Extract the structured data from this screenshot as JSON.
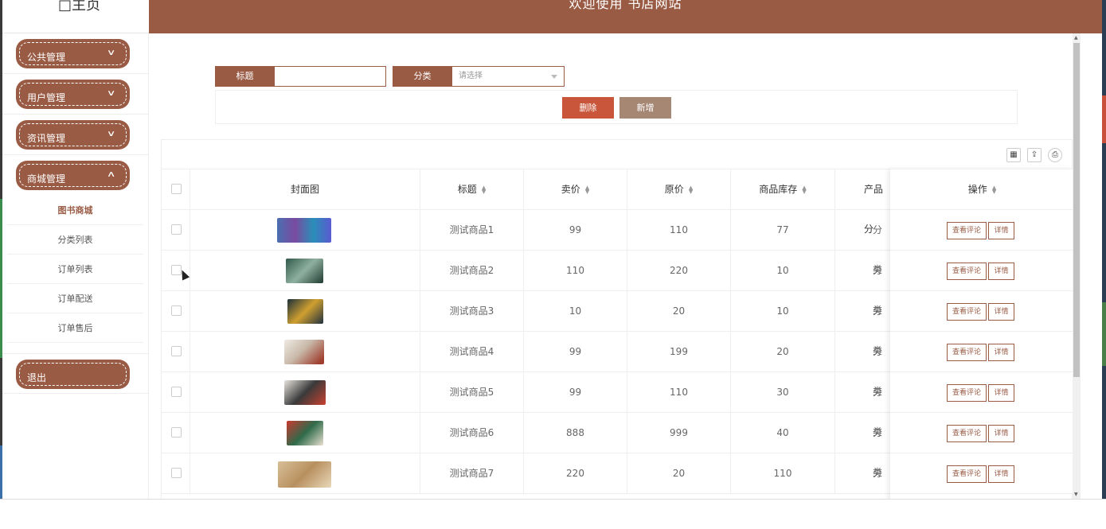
{
  "header": {
    "title": "欢迎使用 书店网站",
    "logo": "□主页"
  },
  "sidebar": {
    "menus": [
      {
        "label": "公共管理",
        "chevron": "down"
      },
      {
        "label": "用户管理",
        "chevron": "down"
      },
      {
        "label": "资讯管理",
        "chevron": "down"
      },
      {
        "label": "商城管理",
        "chevron": "up"
      }
    ],
    "subitems": [
      "图书商城",
      "分类列表",
      "订单列表",
      "订单配送",
      "订单售后"
    ],
    "active_sub": "图书商城",
    "logout": "退出"
  },
  "search": {
    "title_label": "标题",
    "title_value": "",
    "category_label": "分类",
    "category_placeholder": "请选择"
  },
  "buttons": {
    "delete": "删除",
    "add": "新增"
  },
  "colors": {
    "primary": "#9a5b45",
    "delete": "#c9563a",
    "add": "#a68774"
  },
  "table": {
    "columns": [
      "封面图",
      "标题",
      "卖价",
      "原价",
      "商品库存",
      "产品分",
      "操作"
    ],
    "rows": [
      {
        "title": "测试商品1",
        "price": "99",
        "original": "110",
        "stock": "77",
        "category": "分类"
      },
      {
        "title": "测试商品2",
        "price": "110",
        "original": "220",
        "stock": "10",
        "category": "分类"
      },
      {
        "title": "测试商品3",
        "price": "10",
        "original": "20",
        "stock": "10",
        "category": "分类"
      },
      {
        "title": "测试商品4",
        "price": "99",
        "original": "199",
        "stock": "20",
        "category": "分类"
      },
      {
        "title": "测试商品5",
        "price": "99",
        "original": "110",
        "stock": "30",
        "category": "分类"
      },
      {
        "title": "测试商品6",
        "price": "888",
        "original": "999",
        "stock": "40",
        "category": "分类"
      },
      {
        "title": "测试商品7",
        "price": "220",
        "original": "20",
        "stock": "110",
        "category": "分类"
      }
    ],
    "row_actions": {
      "review": "查看评论",
      "detail": "详情"
    }
  },
  "toolbar_icons": [
    "columns-icon",
    "export-icon",
    "print-icon"
  ]
}
